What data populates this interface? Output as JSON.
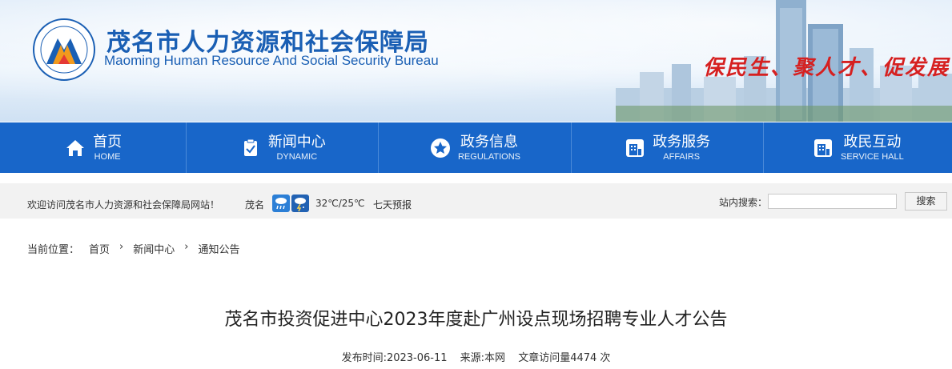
{
  "header": {
    "title_cn": "茂名市人力资源和社会保障局",
    "title_en": "Maoming Human Resource And Social Security Bureau",
    "slogan": "保民生、聚人才、促发展",
    "logo_ring_text": "茂名市人力资源和社会保障局"
  },
  "nav": {
    "items": [
      {
        "cn": "首页",
        "en": "HOME",
        "icon": "home-icon"
      },
      {
        "cn": "新闻中心",
        "en": "DYNAMIC",
        "icon": "clipboard-check-icon"
      },
      {
        "cn": "政务信息",
        "en": "REGULATIONS",
        "icon": "star-circle-icon"
      },
      {
        "cn": "政务服务",
        "en": "AFFAIRS",
        "icon": "building-icon"
      },
      {
        "cn": "政民互动",
        "en": "SERVICE HALL",
        "icon": "building-icon"
      }
    ]
  },
  "infobar": {
    "welcome": "欢迎访问茂名市人力资源和社会保障局网站！",
    "city": "茂名",
    "weather_icons": [
      "rain-icon",
      "thunderstorm-icon"
    ],
    "temperature": "32℃/25℃",
    "forecast": "七天预报",
    "search_label": "站内搜索：",
    "search_value": "",
    "search_button": "搜索"
  },
  "breadcrumb": {
    "prefix": "当前位置：",
    "items": [
      "首页",
      "新闻中心",
      "通知公告"
    ]
  },
  "article": {
    "title": "茂名市投资促进中心2023年度赴广州设点现场招聘专业人才公告",
    "published": "发布时间:2023-06-11",
    "source": "来源:本网",
    "views": "文章访问量4474 次"
  },
  "colors": {
    "nav_bg": "#1866c9",
    "title_blue": "#1a5fb4",
    "slogan_red": "#d62020",
    "infobar_bg": "#f2f2f2"
  }
}
